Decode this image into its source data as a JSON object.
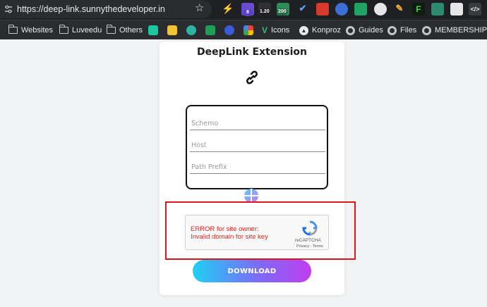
{
  "browser": {
    "url": "https://deep-link.sunnythedeveloper.in",
    "extension_badges": [
      "8",
      "1.20",
      "200"
    ]
  },
  "bookmarks": [
    {
      "label": "Websites",
      "icon": "folder-icon"
    },
    {
      "label": "Luveedu",
      "icon": "folder-icon"
    },
    {
      "label": "Others",
      "icon": "folder-icon"
    },
    {
      "label": "Icons",
      "icon": "vuetify-icon"
    },
    {
      "label": "Konproz",
      "icon": "triangle-icon"
    },
    {
      "label": "Guides",
      "icon": "globe-icon"
    },
    {
      "label": "Files",
      "icon": "globe-icon"
    },
    {
      "label": "MEMBERSHIP",
      "icon": "globe-icon"
    }
  ],
  "page": {
    "title": "DeepLink Extension",
    "fields": {
      "scheme_placeholder": "Schemo",
      "host_placeholder": "Host",
      "path_prefix_placeholder": "Path Prefix"
    },
    "captcha": {
      "error_line1": "ERROR for site owner:",
      "error_line2": "Invalid domain for site key",
      "brand": "reCAPTCHA",
      "terms": "Privacy - Terms"
    },
    "download_label": "DOWNLOAD"
  },
  "colors": {
    "error_red": "#e2231a",
    "highlight_border": "#e0141e",
    "button_gradient_start": "#1fd0f5",
    "button_gradient_end": "#c13df0"
  }
}
